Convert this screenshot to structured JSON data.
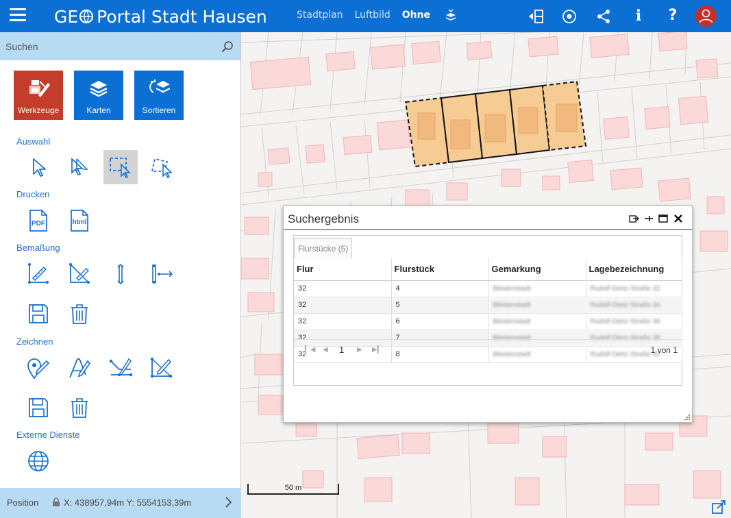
{
  "header": {
    "logo_left": "GE",
    "logo_right": "Portal Stadt Hausen",
    "nav": [
      {
        "label": "Stadtplan",
        "active": false
      },
      {
        "label": "Luftbild",
        "active": false
      },
      {
        "label": "Ohne",
        "active": true
      }
    ],
    "icons": [
      "layers-icon",
      "sidebar-toggle-icon",
      "locate-icon",
      "share-icon",
      "info-icon",
      "help-icon",
      "user-avatar-icon"
    ],
    "info_glyph": "i",
    "help_glyph": "?",
    "accent": "#0c6fd4",
    "avatar_color": "#c4302b"
  },
  "sidebar": {
    "search_placeholder": "Suchen",
    "big_buttons": [
      {
        "label": "Werkzeuge",
        "icon": "tools-icon",
        "color": "#c43d2a"
      },
      {
        "label": "Karten",
        "icon": "layers-icon",
        "color": "#0c6fd4"
      },
      {
        "label": "Sortieren",
        "icon": "sort-layers-icon",
        "color": "#0c6fd4"
      }
    ],
    "sections": {
      "auswahl": "Auswahl",
      "drucken": "Drucken",
      "bemassung": "Bemaßung",
      "zeichnen": "Zeichnen",
      "externe": "Externe Dienste"
    },
    "print_pdf": "PDF",
    "print_html": "html"
  },
  "statusbar": {
    "label": "Position",
    "coords": "X:   438957,94m  Y:  5554153,39m"
  },
  "map": {
    "scale_label": "50 m"
  },
  "dialog": {
    "title": "Suchergebnis",
    "tab_label": "Flurstücke (5)",
    "columns": [
      "Flur",
      "Flurstück",
      "Gemarkung",
      "Lagebezeichnung"
    ],
    "rows": [
      {
        "flur": "32",
        "flurstueck": "4",
        "gemarkung": "Bleidenstadt",
        "lage": "Rudolf-Dietz-Straße 32"
      },
      {
        "flur": "32",
        "flurstueck": "5",
        "gemarkung": "Bleidenstadt",
        "lage": "Rudolf-Dietz-Straße 34"
      },
      {
        "flur": "32",
        "flurstueck": "6",
        "gemarkung": "Bleidenstadt",
        "lage": "Rudolf-Dietz-Straße 36"
      },
      {
        "flur": "32",
        "flurstueck": "7",
        "gemarkung": "Bleidenstadt",
        "lage": "Rudolf-Dietz-Straße 38"
      },
      {
        "flur": "32",
        "flurstueck": "8",
        "gemarkung": "Bleidenstadt",
        "lage": "Rudolf-Dietz-Straße 40"
      }
    ],
    "current_page": "1",
    "page_count": "1 von 1"
  }
}
